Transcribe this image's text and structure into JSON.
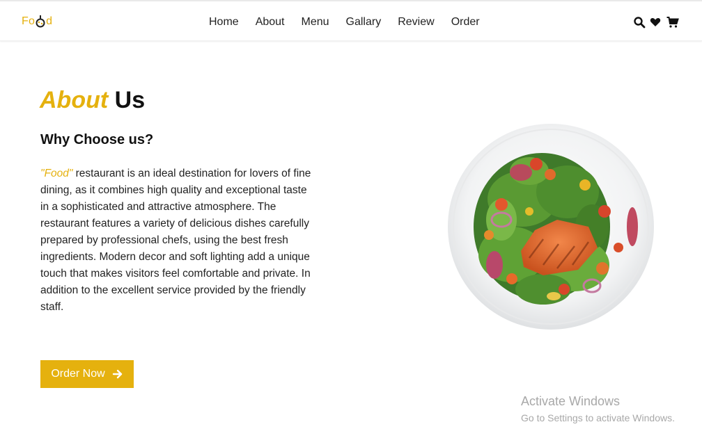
{
  "header": {
    "logo_text_left": "Fo",
    "logo_text_right": "d",
    "nav": [
      {
        "label": "Home"
      },
      {
        "label": "About"
      },
      {
        "label": "Menu"
      },
      {
        "label": "Gallary"
      },
      {
        "label": "Review"
      },
      {
        "label": "Order"
      }
    ],
    "icons": [
      "search-icon",
      "heart-icon",
      "cart-icon"
    ]
  },
  "about": {
    "title_accent": "About",
    "title_rest": "Us",
    "subtitle": "Why Choose us?",
    "brand_quote": "\"Food\"",
    "description": " restaurant is an ideal destination for lovers of fine dining, as it combines high quality and exceptional taste in a sophisticated and attractive atmosphere. The restaurant features a variety of delicious dishes carefully prepared by professional chefs, using the best fresh ingredients. Modern decor and soft lighting add a unique touch that makes visitors feel comfortable and private. In addition to the excellent service provided by the friendly staff.",
    "cta_label": "Order Now",
    "image_alt": "salmon salad plate"
  },
  "overlay": {
    "activate_title": "Activate Windows",
    "activate_sub": "Go to Settings to activate Windows."
  },
  "colors": {
    "accent": "#e5b10e",
    "text": "#111111",
    "watermark": "#a8a8a8"
  }
}
